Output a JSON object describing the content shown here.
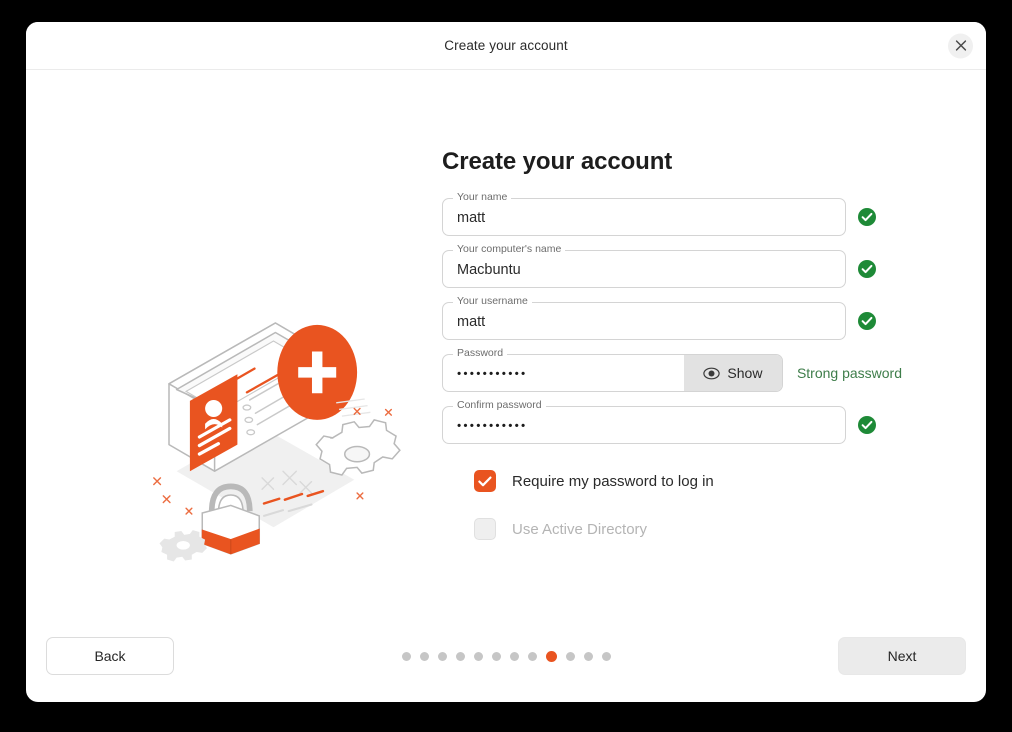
{
  "window": {
    "header_title": "Create your account",
    "close_icon": "close-icon"
  },
  "page": {
    "title": "Create your account"
  },
  "fields": [
    {
      "label": "Your name",
      "value": "matt",
      "status": "valid",
      "status_icon": "check-circle-icon"
    },
    {
      "label": "Your computer's name",
      "value": "Macbuntu",
      "status": "valid",
      "status_icon": "check-circle-icon"
    },
    {
      "label": "Your username",
      "value": "matt",
      "status": "valid",
      "status_icon": "check-circle-icon"
    },
    {
      "label": "Password",
      "value": "•••••••••••",
      "status": "hint",
      "hint": "Strong password",
      "show_label": "Show",
      "show_icon": "eye-icon"
    },
    {
      "label": "Confirm password",
      "value": "•••••••••••",
      "status": "valid",
      "status_icon": "check-circle-icon"
    }
  ],
  "options": [
    {
      "label": "Require my password to log in",
      "checked": true,
      "enabled": true
    },
    {
      "label": "Use Active Directory",
      "checked": false,
      "enabled": false
    }
  ],
  "footer": {
    "back_label": "Back",
    "next_label": "Next",
    "pagination": {
      "total": 12,
      "active_index": 8
    }
  },
  "colors": {
    "accent": "#e95420",
    "success": "#1e8a37",
    "hint_text": "#3e7d4a",
    "dot_inactive": "#c6c6c6"
  },
  "illustration": {
    "name": "create-account-illustration",
    "elements": [
      "monitor",
      "user-profile-card",
      "plus-badge",
      "gear",
      "padlock"
    ]
  }
}
